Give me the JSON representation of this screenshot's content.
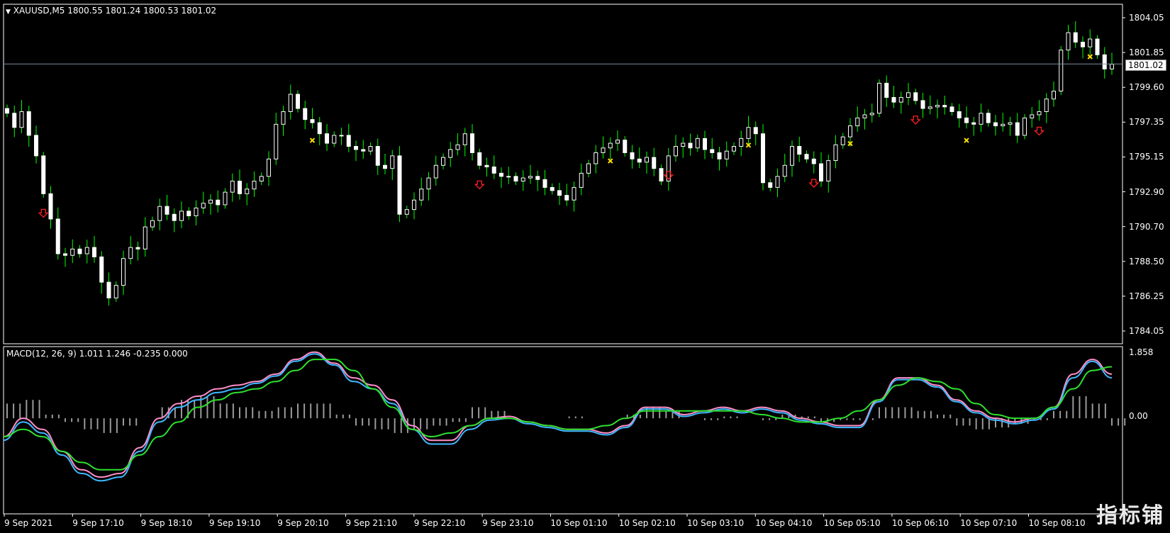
{
  "header": {
    "title": "XAUUSD,M5",
    "ohlc": "1800.55 1801.24 1800.53 1801.02"
  },
  "current_price": "1801.02",
  "indicator_label": "MACD(12, 26, 9) 1.011 1.246 -0.235 0.000",
  "price_axis_labels": [
    "1804.05",
    "1801.85",
    "1799.60",
    "1797.35",
    "1795.15",
    "1792.90",
    "1790.70",
    "1788.50",
    "1786.25",
    "1784.05"
  ],
  "macd_axis_labels": [
    "1.858",
    "0.00"
  ],
  "time_axis_labels": [
    "9 Sep 2021",
    "9 Sep 17:10",
    "9 Sep 18:10",
    "9 Sep 19:10",
    "9 Sep 20:10",
    "9 Sep 21:10",
    "9 Sep 22:10",
    "9 Sep 23:10",
    "10 Sep 01:10",
    "10 Sep 02:10",
    "10 Sep 03:10",
    "10 Sep 04:10",
    "10 Sep 05:10",
    "10 Sep 06:10",
    "10 Sep 07:10",
    "10 Sep 08:10"
  ],
  "watermark": "指标铺",
  "colors": {
    "background": "#000000",
    "bull_candle": "#ffffff",
    "bear_candle": "#ffffff",
    "wick": "#00ff00",
    "macd_fast": "#ff8fc8",
    "macd_slow": "#3fb8ff",
    "macd_signal": "#2ee02e",
    "histogram": "#9a9a9a",
    "arrow_down": "#ff2020",
    "cross": "#ffe000",
    "current_line": "#7a8a9a"
  },
  "chart_data": [
    {
      "type": "candlestick",
      "title": "XAUUSD,M5",
      "ylim": [
        1783.3,
        1804.8
      ],
      "close": [
        1797.9,
        1797.0,
        1798.0,
        1796.5,
        1795.2,
        1792.8,
        1791.2,
        1789.0,
        1788.9,
        1789.3,
        1789.0,
        1789.4,
        1788.8,
        1787.2,
        1786.2,
        1787.0,
        1788.7,
        1789.4,
        1789.3,
        1790.7,
        1791.1,
        1792.0,
        1791.5,
        1791.1,
        1791.7,
        1791.4,
        1791.9,
        1792.2,
        1792.4,
        1792.1,
        1792.9,
        1793.6,
        1792.8,
        1793.1,
        1793.6,
        1793.9,
        1795.0,
        1797.2,
        1798.0,
        1799.1,
        1798.2,
        1797.5,
        1797.3,
        1796.6,
        1796.0,
        1796.5,
        1796.5,
        1795.8,
        1795.6,
        1795.5,
        1795.8,
        1794.6,
        1794.4,
        1795.2,
        1791.5,
        1791.8,
        1792.4,
        1793.1,
        1793.8,
        1794.6,
        1795.1,
        1795.6,
        1795.9,
        1796.6,
        1795.4,
        1794.6,
        1794.5,
        1794.1,
        1793.9,
        1793.9,
        1793.6,
        1793.8,
        1793.9,
        1793.7,
        1793.2,
        1793.0,
        1792.7,
        1792.4,
        1793.2,
        1794.1,
        1794.7,
        1795.4,
        1795.7,
        1796.0,
        1796.2,
        1795.4,
        1795.0,
        1794.8,
        1795.1,
        1794.4,
        1793.6,
        1795.2,
        1795.8,
        1796.0,
        1795.7,
        1796.3,
        1795.6,
        1795.4,
        1795.0,
        1795.5,
        1795.8,
        1796.3,
        1797.0,
        1796.6,
        1793.5,
        1793.2,
        1793.9,
        1794.6,
        1795.8,
        1795.3,
        1795.0,
        1794.7,
        1793.6,
        1794.9,
        1795.9,
        1796.4,
        1797.1,
        1797.6,
        1797.8,
        1797.9,
        1799.8,
        1798.9,
        1798.6,
        1798.9,
        1799.2,
        1798.7,
        1798.2,
        1798.3,
        1798.4,
        1798.3,
        1798.0,
        1797.6,
        1797.3,
        1797.2,
        1797.9,
        1797.3,
        1797.1,
        1797.2,
        1797.3,
        1796.5,
        1797.6,
        1797.8,
        1798.0,
        1798.8,
        1799.3,
        1801.9,
        1803.0,
        1802.4,
        1802.1,
        1802.6,
        1801.6,
        1800.7,
        1801.0
      ],
      "ylabel": "",
      "xlabel": ""
    },
    {
      "type": "line",
      "title": "MACD(12, 26, 9) 1.011 1.246 -0.235 0.000",
      "ylim": [
        -2.6,
        1.95
      ],
      "series": [
        {
          "values": [
            -0.5,
            0.0,
            -0.3,
            -0.9,
            -1.4,
            -1.6,
            -1.5,
            -0.8,
            0.0,
            0.4,
            0.6,
            0.8,
            0.9,
            1.0,
            1.2,
            1.6,
            1.8,
            1.5,
            1.1,
            0.9,
            0.5,
            -0.2,
            -0.6,
            -0.6,
            -0.2,
            0.0,
            0.05,
            -0.1,
            -0.2,
            -0.3,
            -0.3,
            -0.4,
            -0.2,
            0.3,
            0.3,
            0.1,
            0.2,
            0.3,
            0.2,
            0.3,
            0.2,
            0.0,
            -0.1,
            -0.2,
            -0.2,
            0.5,
            1.1,
            1.1,
            0.9,
            0.5,
            0.2,
            0.0,
            -0.1,
            0.0,
            0.3,
            1.2,
            1.6,
            1.2
          ]
        },
        {
          "values": [
            -0.6,
            -0.1,
            -0.4,
            -1.0,
            -1.5,
            -1.7,
            -1.6,
            -0.9,
            -0.1,
            0.3,
            0.5,
            0.7,
            0.8,
            0.95,
            1.15,
            1.55,
            1.75,
            1.45,
            1.0,
            0.8,
            0.4,
            -0.3,
            -0.7,
            -0.7,
            -0.3,
            -0.05,
            0.0,
            -0.15,
            -0.25,
            -0.35,
            -0.35,
            -0.45,
            -0.25,
            0.25,
            0.25,
            0.05,
            0.15,
            0.25,
            0.15,
            0.25,
            0.15,
            -0.05,
            -0.15,
            -0.25,
            -0.25,
            0.45,
            1.05,
            1.05,
            0.85,
            0.45,
            0.15,
            -0.05,
            -0.15,
            -0.05,
            0.25,
            1.1,
            1.55,
            1.1
          ]
        },
        {
          "values": [
            -0.5,
            -0.3,
            -0.5,
            -0.9,
            -1.2,
            -1.4,
            -1.4,
            -1.0,
            -0.5,
            -0.1,
            0.3,
            0.5,
            0.7,
            0.8,
            1.0,
            1.3,
            1.6,
            1.6,
            1.3,
            0.8,
            0.3,
            -0.3,
            -0.5,
            -0.4,
            -0.2,
            0.0,
            0.0,
            -0.1,
            -0.2,
            -0.3,
            -0.3,
            -0.2,
            0.0,
            0.2,
            0.2,
            0.2,
            0.2,
            0.2,
            0.2,
            0.1,
            0.0,
            -0.1,
            -0.1,
            0.0,
            0.2,
            0.5,
            0.9,
            1.1,
            1.0,
            0.8,
            0.4,
            0.1,
            0.0,
            0.0,
            0.3,
            0.8,
            1.3,
            1.4
          ]
        }
      ],
      "histogram": [
        0.4,
        0.5,
        0.1,
        -0.1,
        -0.3,
        -0.4,
        -0.2,
        0.0,
        0.3,
        0.5,
        0.6,
        0.4,
        0.3,
        0.2,
        0.3,
        0.4,
        0.4,
        0.1,
        -0.2,
        -0.3,
        -0.4,
        -0.3,
        -0.2,
        -0.1,
        0.3,
        0.2,
        0.0,
        0.0,
        0.0,
        0.05,
        0.0,
        0.0,
        0.1,
        0.3,
        0.2,
        0.0,
        -0.05,
        0.05,
        0.0,
        -0.05,
        0.1,
        0.05,
        -0.1,
        -0.05,
        -0.05,
        0.3,
        0.3,
        0.2,
        0.1,
        -0.2,
        -0.3,
        -0.25,
        -0.15,
        -0.05,
        0.2,
        0.6,
        0.4,
        -0.2
      ],
      "xlabel": "",
      "ylabel": ""
    }
  ]
}
